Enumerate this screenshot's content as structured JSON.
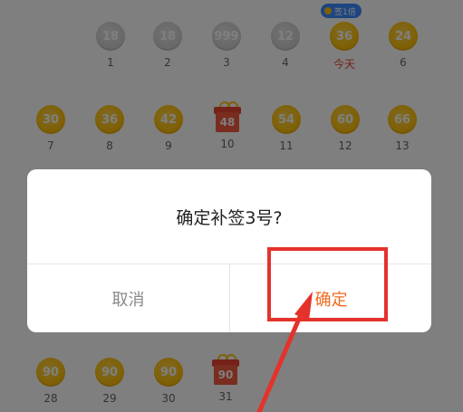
{
  "badge": {
    "text": "签1倍"
  },
  "calendar": {
    "row1": [
      {
        "coin": "18",
        "label": "1",
        "style": "gray"
      },
      {
        "coin": "18",
        "label": "2",
        "style": "gray"
      },
      {
        "coin": "999",
        "label": "3",
        "style": "gray"
      },
      {
        "coin": "12",
        "label": "4",
        "style": "gray"
      },
      {
        "coin": "36",
        "label": "今天",
        "style": "gold"
      },
      {
        "coin": "24",
        "label": "6",
        "style": "gold"
      }
    ],
    "row2": [
      {
        "coin": "30",
        "label": "7",
        "style": "gold"
      },
      {
        "coin": "36",
        "label": "8",
        "style": "gold"
      },
      {
        "coin": "42",
        "label": "9",
        "style": "gold"
      },
      {
        "coin": "48",
        "label": "10",
        "style": "gift"
      },
      {
        "coin": "54",
        "label": "11",
        "style": "gold"
      },
      {
        "coin": "60",
        "label": "12",
        "style": "gold"
      },
      {
        "coin": "66",
        "label": "13",
        "style": "gold"
      }
    ],
    "row5": [
      {
        "coin": "90",
        "label": "28",
        "style": "gold"
      },
      {
        "coin": "90",
        "label": "29",
        "style": "gold"
      },
      {
        "coin": "90",
        "label": "30",
        "style": "gold"
      },
      {
        "coin": "90",
        "label": "31",
        "style": "gift"
      }
    ]
  },
  "dialog": {
    "title": "确定补签3号?",
    "cancel_label": "取消",
    "confirm_label": "确定"
  },
  "colors": {
    "confirm": "#f06a1f",
    "highlight": "#e4322b",
    "coin": "#ffc20e"
  }
}
